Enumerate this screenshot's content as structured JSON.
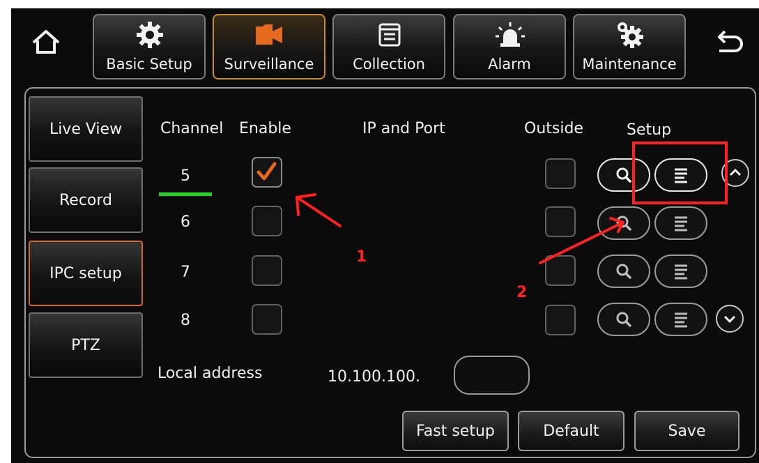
{
  "colors": {
    "accent_orange": "#e66a1e",
    "annotation_red": "#ff2020",
    "underline_green": "#1fd41f"
  },
  "nav": {
    "home_icon": "home-icon",
    "back_icon": "return-arrow-icon",
    "tabs": [
      {
        "label": "Basic Setup",
        "icon": "gear-icon",
        "active": false
      },
      {
        "label": "Surveillance",
        "icon": "video-camera-icon",
        "active": true
      },
      {
        "label": "Collection",
        "icon": "window-icon",
        "active": false
      },
      {
        "label": "Alarm",
        "icon": "siren-icon",
        "active": false
      },
      {
        "label": "Maintenance",
        "icon": "gears-icon",
        "active": false
      }
    ]
  },
  "sidebar": {
    "items": [
      {
        "label": "Live View",
        "active": false
      },
      {
        "label": "Record",
        "active": false
      },
      {
        "label": "IPC setup",
        "active": true
      },
      {
        "label": "PTZ",
        "active": false
      }
    ]
  },
  "table": {
    "headers": {
      "channel": "Channel",
      "enable": "Enable",
      "ip_port": "IP and Port",
      "outside": "Outside",
      "setup": "Setup"
    },
    "rows": [
      {
        "channel": "5",
        "enabled": true,
        "outside": false
      },
      {
        "channel": "6",
        "enabled": false,
        "outside": false
      },
      {
        "channel": "7",
        "enabled": false,
        "outside": false
      },
      {
        "channel": "8",
        "enabled": false,
        "outside": false
      }
    ]
  },
  "local_address": {
    "label": "Local address",
    "prefix": "10.100.100.",
    "value": ""
  },
  "buttons": {
    "fast_setup": "Fast setup",
    "default": "Default",
    "save": "Save"
  },
  "annotations": {
    "marker_1": "1",
    "marker_2": "2"
  }
}
